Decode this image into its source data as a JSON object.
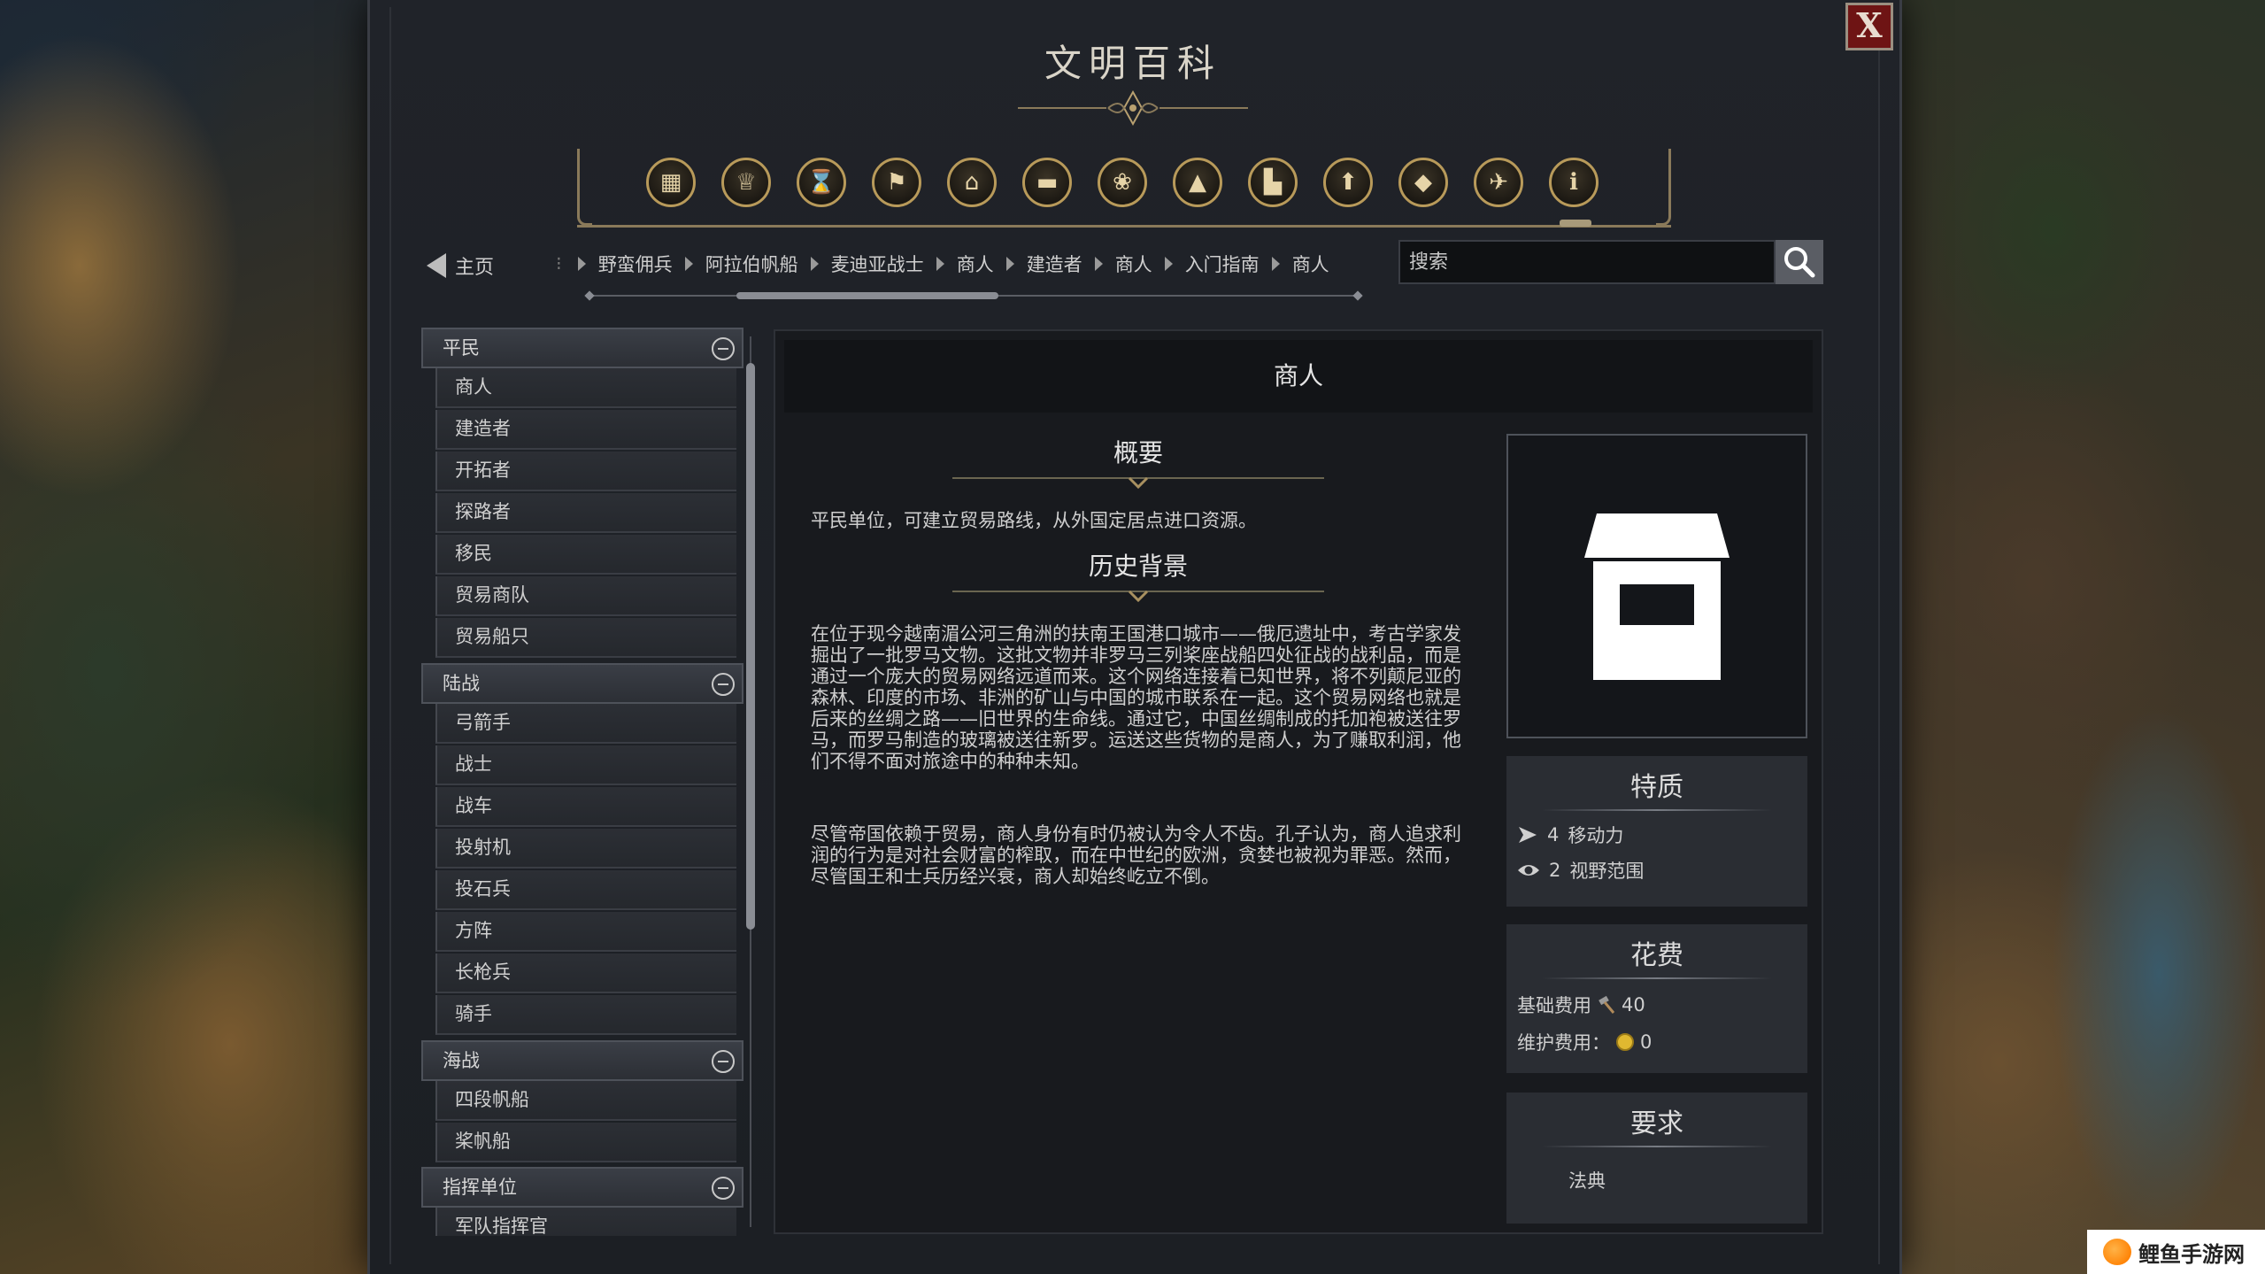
{
  "window": {
    "title": "文明百科",
    "close_label": "X"
  },
  "categories": [
    {
      "icon": "box-icon",
      "glyph": "▦"
    },
    {
      "icon": "grail-icon",
      "glyph": "♕"
    },
    {
      "icon": "hourglass-icon",
      "glyph": "⌛"
    },
    {
      "icon": "flag-icon",
      "glyph": "⚑"
    },
    {
      "icon": "temple-icon",
      "glyph": "⌂"
    },
    {
      "icon": "book-icon",
      "glyph": "▬"
    },
    {
      "icon": "bazaar-icon",
      "glyph": "❀"
    },
    {
      "icon": "mountain-icon",
      "glyph": "▲"
    },
    {
      "icon": "building-icon",
      "glyph": "▙"
    },
    {
      "icon": "upgrade-arrow-icon",
      "glyph": "⬆"
    },
    {
      "icon": "resource-icon",
      "glyph": "◆"
    },
    {
      "icon": "dove-icon",
      "glyph": "✈"
    },
    {
      "icon": "info-icon",
      "glyph": "ℹ"
    }
  ],
  "nav": {
    "home_label": "主页",
    "breadcrumbs": [
      "野蛮佣兵",
      "阿拉伯帆船",
      "麦迪亚战士",
      "商人",
      "建造者",
      "商人",
      "入门指南",
      "商人"
    ]
  },
  "search": {
    "placeholder": "搜索"
  },
  "sidebar": {
    "groups": [
      {
        "label": "平民",
        "items": [
          "商人",
          "建造者",
          "开拓者",
          "探路者",
          "移民",
          "贸易商队",
          "贸易船只"
        ]
      },
      {
        "label": "陆战",
        "items": [
          "弓箭手",
          "战士",
          "战车",
          "投射机",
          "投石兵",
          "方阵",
          "长枪兵",
          "骑手"
        ]
      },
      {
        "label": "海战",
        "items": [
          "四段帆船",
          "桨帆船"
        ]
      },
      {
        "label": "指挥单位",
        "items": [
          "军队指挥官"
        ]
      }
    ]
  },
  "article": {
    "title": "商人",
    "overview_heading": "概要",
    "overview_text": "平民单位，可建立贸易路线，从外国定居点进口资源。",
    "history_heading": "历史背景",
    "history_p1": "在位于现今越南湄公河三角洲的扶南王国港口城市——俄厄遗址中，考古学家发掘出了一批罗马文物。这批文物并非罗马三列桨座战船四处征战的战利品，而是通过一个庞大的贸易网络远道而来。这个网络连接着已知世界，将不列颠尼亚的森林、印度的市场、非洲的矿山与中国的城市联系在一起。这个贸易网络也就是后来的丝绸之路——旧世界的生命线。通过它，中国丝绸制成的托加袍被送往罗马，而罗马制造的玻璃被送往新罗。运送这些货物的是商人，为了赚取利润，他们不得不面对旅途中的种种未知。",
    "history_p2": "尽管帝国依赖于贸易，商人身份有时仍被认为令人不齿。孔子认为，商人追求利润的行为是对社会财富的榨取，而在中世纪的欧洲，贪婪也被视为罪恶。然而，尽管国王和士兵历经兴衰，商人却始终屹立不倒。"
  },
  "traits": {
    "heading": "特质",
    "movement_value": "4",
    "movement_label": "移动力",
    "sight_value": "2",
    "sight_label": "视野范围"
  },
  "cost": {
    "heading": "花费",
    "base_label": "基础费用",
    "base_value": "40",
    "maintenance_label": "维护费用：",
    "maintenance_value": "0"
  },
  "requirements": {
    "heading": "要求",
    "item": "法典"
  },
  "watermark": {
    "text": "鲤鱼手游网"
  }
}
